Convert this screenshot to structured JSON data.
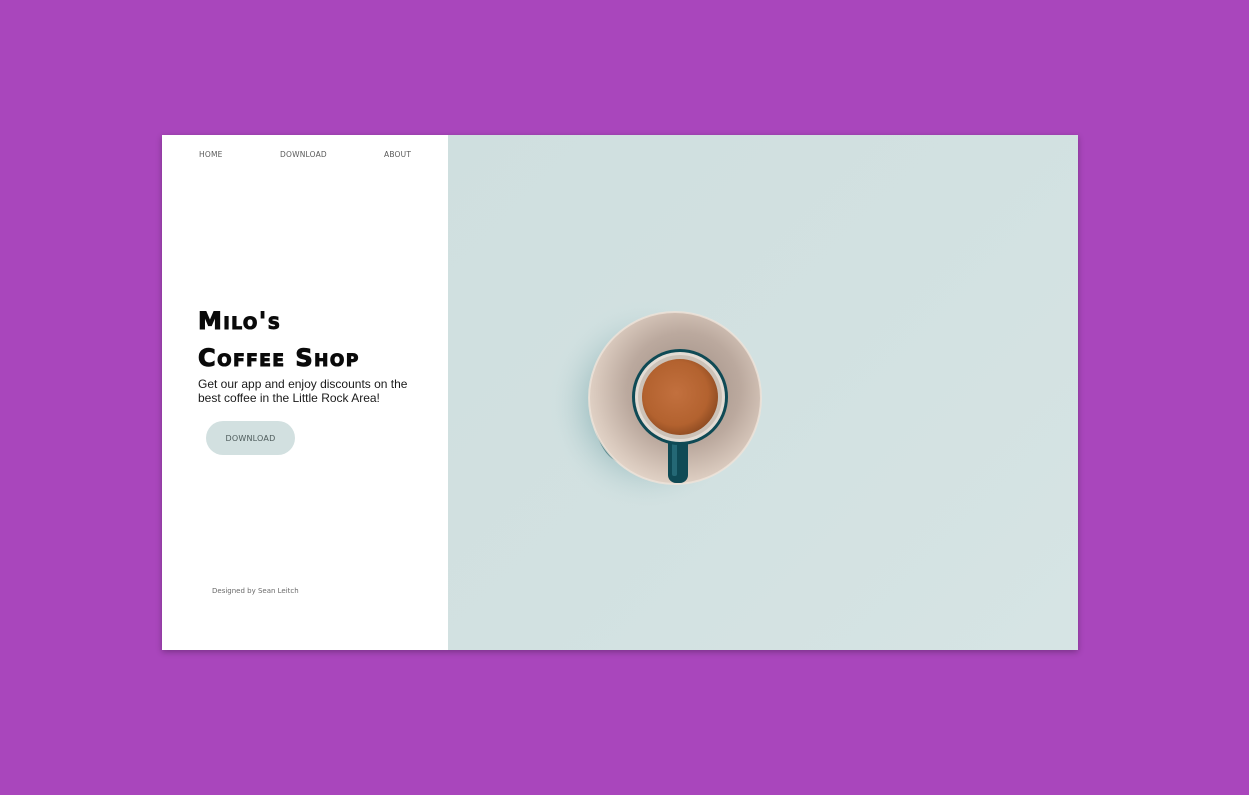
{
  "nav": {
    "items": [
      "HOME",
      "DOWNLOAD",
      "ABOUT"
    ]
  },
  "hero": {
    "title_line1": "Milo's",
    "title_line2": "Coffee Shop",
    "tagline": "Get our app and enjoy discounts on the best coffee in the Little Rock Area!",
    "cta_label": "DOWNLOAD"
  },
  "footer": {
    "credit": "Designed by Sean Leitch"
  },
  "colors": {
    "page_background": "#a946bc",
    "button_background": "#d2e0e0",
    "image_background": "#d0e0e0"
  },
  "image": {
    "subject": "coffee-cup-top-view"
  }
}
